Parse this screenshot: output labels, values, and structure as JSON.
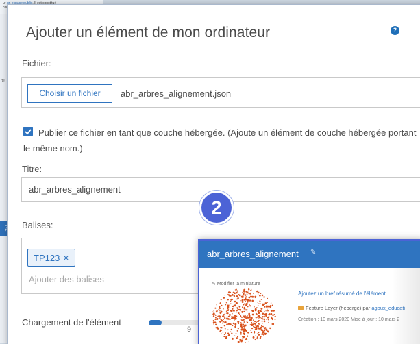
{
  "background": {
    "snippet_prefix": "ur",
    "snippet_link": "un espace public",
    "snippet_suffix": ". Il est constitué",
    "snippet_line2": "cor",
    "side_frag_1": "rte",
    "side_frag_2": "RÉ"
  },
  "dialog": {
    "title": "Ajouter un élément de mon ordinateur",
    "help_icon": "?"
  },
  "file": {
    "label": "Fichier:",
    "choose_button": "Choisir un fichier",
    "file_name": "abr_arbres_alignement.json"
  },
  "publish": {
    "checked": true,
    "text": "Publier ce fichier en tant que couche hébergée. (Ajoute un élément de couche hébergée portant le même nom.)"
  },
  "title_field": {
    "label": "Titre:",
    "value": "abr_arbres_alignement"
  },
  "tags": {
    "label": "Balises:",
    "chips": [
      "TP123"
    ],
    "chip_close": "×",
    "placeholder": "Ajouter des balises"
  },
  "progress": {
    "label": "Chargement de l'élément",
    "fraction": 0.16,
    "percent_text": "9"
  },
  "badge": {
    "number": "2"
  },
  "item_card": {
    "title": "abr_arbres_alignement",
    "edit_icon": "pencil-icon",
    "thumbnail_edit": "Modifier la miniature",
    "summary_link": "Ajoutez un bref résumé de l'élément.",
    "type_text": "Feature Layer (hébergé) par",
    "owner": "agoux_educati",
    "dates": "Création : 10 mars 2020   Mise à jour : 10 mars 2"
  },
  "colors": {
    "accent": "#2f74c0",
    "badge": "#4c63d6",
    "thumbnail": "#d9531e"
  }
}
